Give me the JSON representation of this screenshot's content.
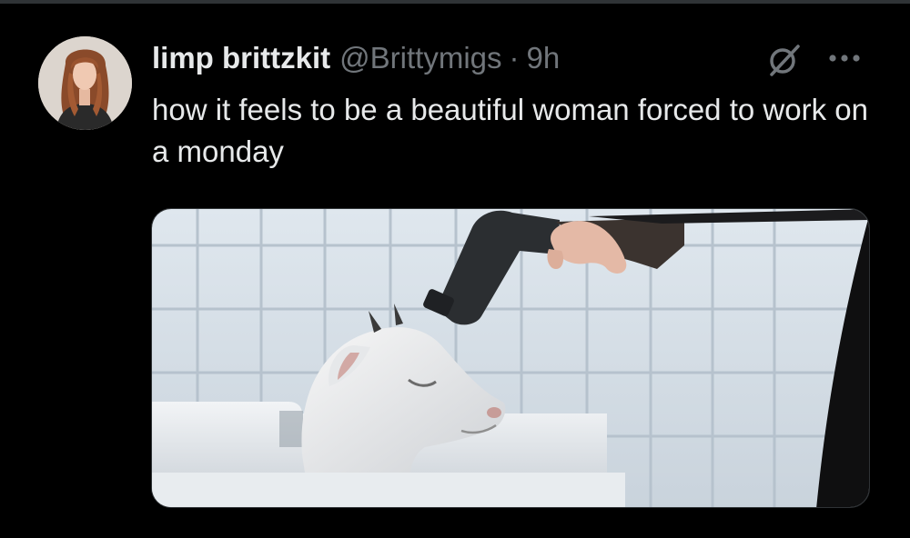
{
  "tweet": {
    "display_name": "limp brittzkit",
    "handle": "@Brittymigs",
    "separator": "·",
    "time": "9h",
    "text": "how it feels to be a beautiful woman forced to work on a monday"
  },
  "icons": {
    "grok": "grok-slash-circle-icon",
    "more": "more-horizontal-icon"
  },
  "colors": {
    "background": "#000000",
    "primary_text": "#e7e9ea",
    "secondary_text": "#71767b",
    "border": "#2f3336"
  }
}
